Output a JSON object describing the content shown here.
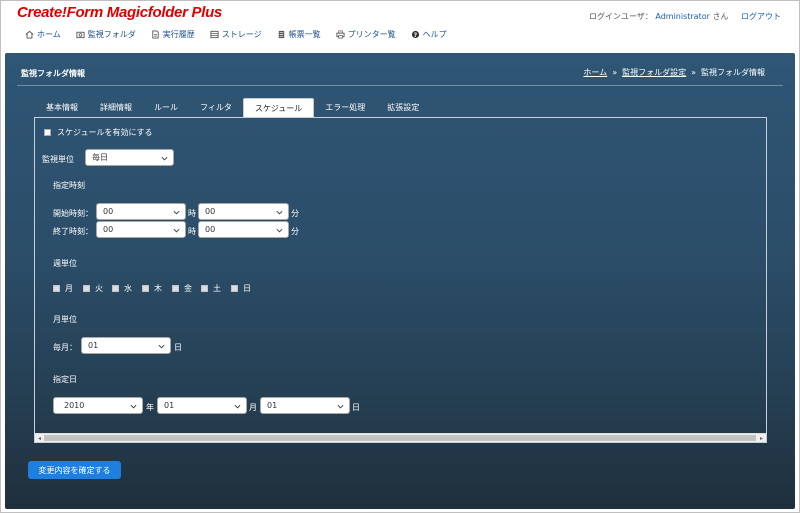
{
  "header": {
    "logo": "Create!Form Magicfolder Plus",
    "login_prefix": "ログインユーザ：",
    "user_name": "Administrator",
    "user_suffix": "さん",
    "logout": "ログアウト"
  },
  "nav": [
    {
      "label": "ホーム",
      "icon": "home-icon"
    },
    {
      "label": "監視フォルダ",
      "icon": "folder-monitor-icon"
    },
    {
      "label": "実行履歴",
      "icon": "document-icon"
    },
    {
      "label": "ストレージ",
      "icon": "storage-icon"
    },
    {
      "label": "帳票一覧",
      "icon": "list-icon"
    },
    {
      "label": "プリンター覧",
      "icon": "printer-icon"
    },
    {
      "label": "ヘルプ",
      "icon": "help-icon"
    }
  ],
  "panel": {
    "title": "監視フォルダ情報",
    "breadcrumb": [
      "ホーム",
      "監視フォルダ設定",
      "監視フォルダ情報"
    ],
    "breadcrumb_sep": "»"
  },
  "tabs": [
    "基本情報",
    "詳細情報",
    "ルール",
    "フィルタ",
    "スケジュール",
    "エラー処理",
    "拡張設定"
  ],
  "active_tab": "スケジュール",
  "schedule": {
    "enable_label": "スケジュールを有効にする",
    "unit_label": "監視単位",
    "unit_value": "毎日",
    "time_section": "指定時刻",
    "start_label": "開始時刻：",
    "end_label": "終了時刻：",
    "start_hour": "00",
    "start_min": "00",
    "end_hour": "00",
    "end_min": "00",
    "hour_suffix": "時",
    "min_suffix": "分",
    "week_section": "週単位",
    "weekdays": [
      "月",
      "火",
      "水",
      "木",
      "金",
      "土",
      "日"
    ],
    "month_section": "月単位",
    "monthly_label": "毎月：",
    "monthly_day": "01",
    "day_suffix": "日",
    "date_section": "指定日",
    "year_value": "2010",
    "year_suffix": "年",
    "month_value": "01",
    "month_suffix": "月",
    "date_value": "01",
    "date_suffix": "日"
  },
  "confirm_button": "変更内容を確定する",
  "colors": {
    "logo": "#e00000",
    "link": "#1a5fb4",
    "button": "#1e7fe0",
    "panel_top": "#2f5676",
    "panel_bottom": "#1f2f3c"
  }
}
